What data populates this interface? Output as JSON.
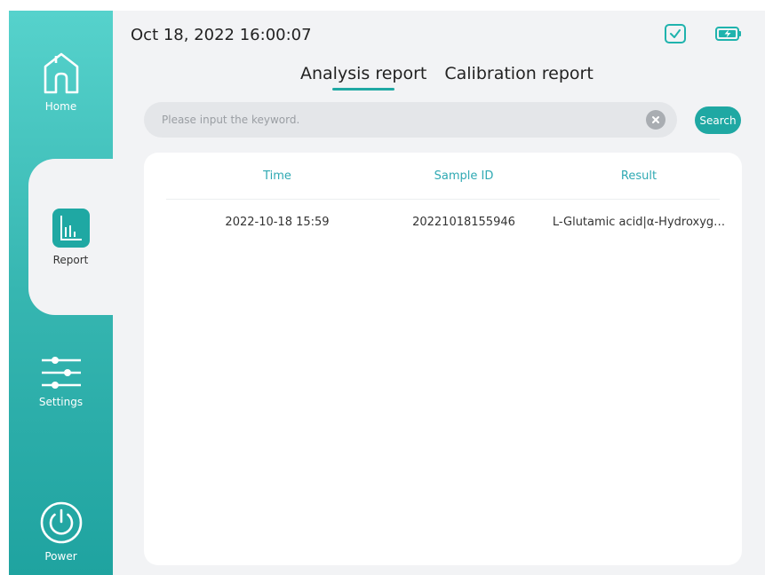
{
  "sidebar": {
    "items": [
      {
        "label": "Home",
        "icon": "home-icon"
      },
      {
        "label": "Report",
        "icon": "report-icon",
        "active": true
      },
      {
        "label": "Settings",
        "icon": "settings-sliders-icon"
      },
      {
        "label": "Power",
        "icon": "power-icon"
      }
    ]
  },
  "header": {
    "datetime": "Oct 18, 2022 16:00:07",
    "status_icons": [
      "check-icon",
      "battery-charging-icon"
    ]
  },
  "tabs": [
    {
      "label": "Analysis report",
      "active": true
    },
    {
      "label": "Calibration report",
      "active": false
    }
  ],
  "search": {
    "placeholder": "Please input the keyword.",
    "value": "",
    "button_label": "Search"
  },
  "table": {
    "columns": [
      "Time",
      "Sample ID",
      "Result"
    ],
    "rows": [
      [
        "2022-10-18 15:59",
        "20221018155946",
        "L-Glutamic acid|α-Hydroxyg…"
      ]
    ]
  },
  "colors": {
    "accent": "#1fa8a3",
    "sidebar_top": "#56d2cc",
    "sidebar_bottom": "#1fa3a0",
    "header_text": "#2fa9b3",
    "panel_bg": "#f2f3f5"
  }
}
